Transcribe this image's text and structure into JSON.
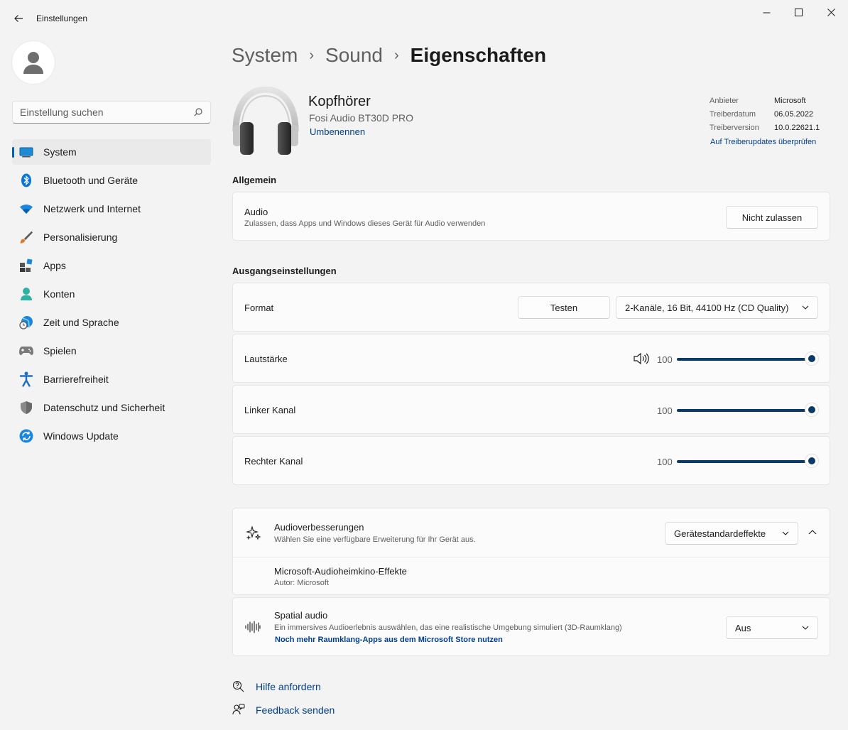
{
  "window": {
    "title": "Einstellungen"
  },
  "sidebar": {
    "search_placeholder": "Einstellung suchen",
    "items": [
      {
        "label": "System",
        "icon": "system-icon",
        "active": true
      },
      {
        "label": "Bluetooth und Geräte",
        "icon": "bluetooth-icon"
      },
      {
        "label": "Netzwerk und Internet",
        "icon": "wifi-icon"
      },
      {
        "label": "Personalisierung",
        "icon": "brush-icon"
      },
      {
        "label": "Apps",
        "icon": "apps-icon"
      },
      {
        "label": "Konten",
        "icon": "account-icon"
      },
      {
        "label": "Zeit und Sprache",
        "icon": "globe-clock-icon"
      },
      {
        "label": "Spielen",
        "icon": "gamepad-icon"
      },
      {
        "label": "Barrierefreiheit",
        "icon": "accessibility-icon"
      },
      {
        "label": "Datenschutz und Sicherheit",
        "icon": "shield-icon"
      },
      {
        "label": "Windows Update",
        "icon": "update-icon"
      }
    ]
  },
  "breadcrumb": {
    "items": [
      "System",
      "Sound"
    ],
    "current": "Eigenschaften",
    "separator": "›"
  },
  "device": {
    "name": "Kopfhörer",
    "model": "Fosi Audio BT30D PRO",
    "rename": "Umbenennen",
    "info": [
      {
        "key": "Anbieter",
        "value": "Microsoft"
      },
      {
        "key": "Treiberdatum",
        "value": "06.05.2022"
      },
      {
        "key": "Treiberversion",
        "value": "10.0.22621.1"
      }
    ],
    "driver_link": "Auf Treiberupdates überprüfen"
  },
  "general": {
    "title": "Allgemein",
    "audio": {
      "title": "Audio",
      "subtitle": "Zulassen, dass Apps und Windows dieses Gerät für Audio verwenden",
      "button": "Nicht zulassen"
    }
  },
  "output": {
    "title": "Ausgangseinstellungen",
    "format": {
      "label": "Format",
      "test_button": "Testen",
      "value": "2-Kanäle, 16 Bit, 44100 Hz (CD Quality)"
    },
    "volume": {
      "label": "Lautstärke",
      "value": "100",
      "level": 1.0
    },
    "left": {
      "label": "Linker Kanal",
      "value": "100",
      "level": 1.0
    },
    "right": {
      "label": "Rechter Kanal",
      "value": "100",
      "level": 1.0
    }
  },
  "enhancements": {
    "title": "Audioverbesserungen",
    "subtitle": "Wählen Sie eine verfügbare Erweiterung für Ihr Gerät aus.",
    "value": "Gerätestandardeffekte",
    "effect": {
      "title": "Microsoft-Audioheimkino-Effekte",
      "author": "Autor: Microsoft"
    }
  },
  "spatial": {
    "title": "Spatial audio",
    "subtitle": "Ein immersives Audioerlebnis auswählen, das eine realistische Umgebung simuliert (3D-Raumklang)",
    "link": "Noch mehr Raumklang-Apps aus dem Microsoft Store nutzen",
    "value": "Aus"
  },
  "footer": {
    "help": "Hilfe anfordern",
    "feedback": "Feedback senden"
  },
  "colors": {
    "accent": "#005fb8",
    "slider": "#0b3a66",
    "link": "#003e92"
  }
}
